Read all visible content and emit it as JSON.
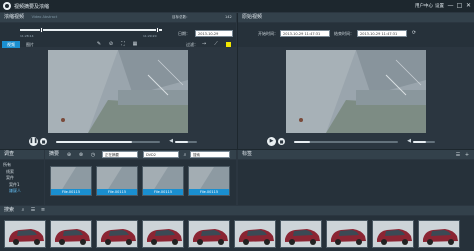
{
  "app": {
    "title": "视频摘要及浓缩"
  },
  "titlebar": {
    "user_center": "用户中心",
    "settings": "设置",
    "min": "—",
    "max": "□",
    "close": "✕"
  },
  "left_panel": {
    "title": "浓缩视频",
    "title_sub": "Video Abstract",
    "total_label": "目标总数：",
    "total_value": "142",
    "tabs": [
      "视频",
      "图片"
    ],
    "start_time": "11:28:14",
    "end_time": "11:29:20",
    "date_label": "日期：",
    "date_value": "2013-10-29",
    "filter_label": "过滤：",
    "filter_color": "#f2e600"
  },
  "right_panel": {
    "title": "原始视频",
    "start_label": "开始时间：",
    "start_value": "2013-10-29 11:47:31",
    "end_label": "结束时间：",
    "end_value": "2013-10-29 11:47:31"
  },
  "investigate": {
    "title": "调查",
    "tree": [
      "所有",
      "线索",
      "案件",
      "案件1",
      "嫌疑人"
    ]
  },
  "summary": {
    "title": "摘要",
    "select1": "正在摘要",
    "select2": "DVD2",
    "search_placeholder": "搜索",
    "thumbs": [
      "File.00115",
      "File.00115",
      "File.00115",
      "File.00115"
    ]
  },
  "tags": {
    "title": "标签"
  },
  "search": {
    "title": "搜索",
    "result_count": 10
  }
}
